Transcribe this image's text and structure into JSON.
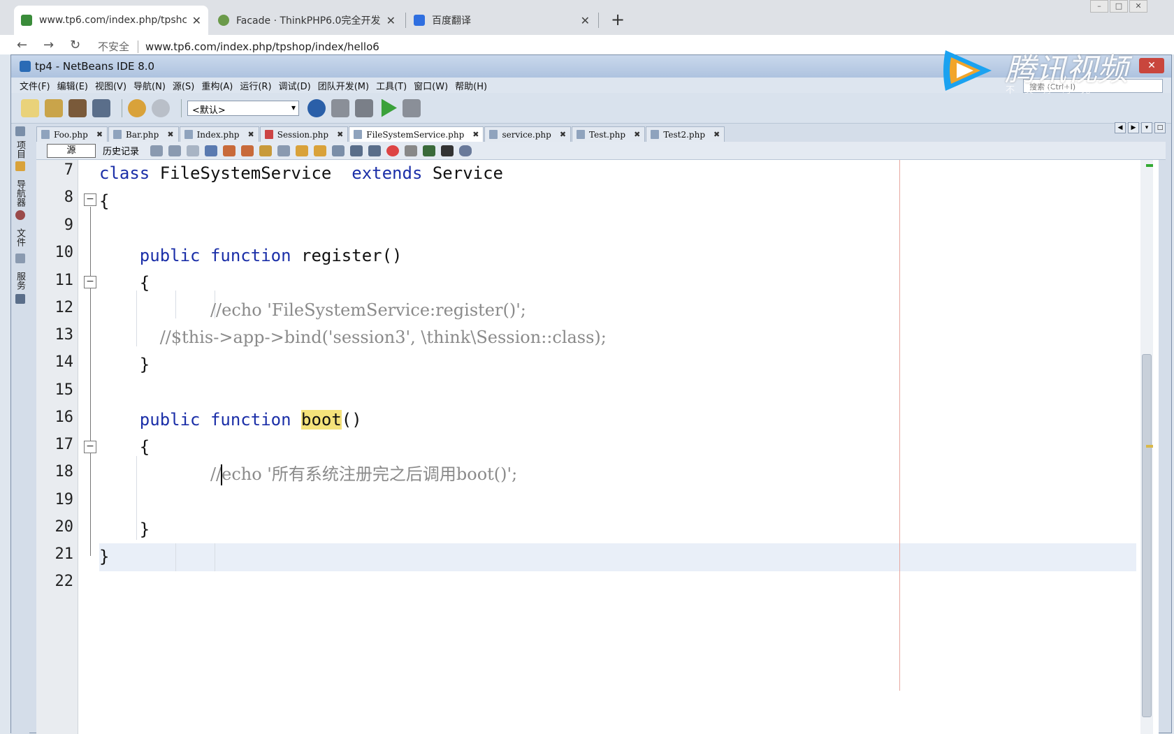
{
  "browser": {
    "tabs": [
      {
        "title": "www.tp6.com/index.php/tpshc",
        "active": true
      },
      {
        "title": "Facade · ThinkPHP6.0完全开发",
        "active": false
      },
      {
        "title": "百度翻译",
        "active": false
      }
    ],
    "url_security": "不安全",
    "url": "www.tp6.com/index.php/tpshop/index/hello6"
  },
  "ide": {
    "title": "tp4 - NetBeans IDE 8.0",
    "menu": [
      "文件(F)",
      "编辑(E)",
      "视图(V)",
      "导航(N)",
      "源(S)",
      "重构(A)",
      "运行(R)",
      "调试(D)",
      "团队开发(M)",
      "工具(T)",
      "窗口(W)",
      "帮助(H)"
    ],
    "search_placeholder": "搜索 (Ctrl+I)",
    "config_select": "<默认>",
    "side_panels": [
      "项目",
      "导航器",
      "文件",
      "服务"
    ],
    "editor_tabs": [
      {
        "label": "Foo.php",
        "active": false
      },
      {
        "label": "Bar.php",
        "active": false
      },
      {
        "label": "Index.php",
        "active": false
      },
      {
        "label": "Session.php",
        "active": false
      },
      {
        "label": "FileSystemService.php",
        "active": true
      },
      {
        "label": "service.php",
        "active": false
      },
      {
        "label": "Test.php",
        "active": false
      },
      {
        "label": "Test2.php",
        "active": false
      }
    ],
    "source_tab": "源",
    "history_tab": "历史记录"
  },
  "code": {
    "line_numbers": [
      "7",
      "8",
      "9",
      "10",
      "11",
      "12",
      "13",
      "14",
      "15",
      "16",
      "17",
      "18",
      "19",
      "20",
      "21",
      "22"
    ],
    "l7": {
      "kw1": "class",
      "name": "FileSystemService",
      "kw2": "extends",
      "parent": "Service"
    },
    "l8": "{",
    "l10": {
      "kw1": "public",
      "kw2": "function",
      "name": "register",
      "rest": "()"
    },
    "l11": "{",
    "l12": "//echo 'FileSystemService:register()';",
    "l13": "//$this->app->bind('session3', \\think\\Session::class);",
    "l14": "}",
    "l16": {
      "kw1": "public",
      "kw2": "function",
      "name": "boot",
      "rest": "()"
    },
    "l17": "{",
    "l18_pre": "//",
    "l18_post": "echo '所有系统注册完之后调用boot()';",
    "l20": "}",
    "l21": "}"
  },
  "watermark": {
    "brand": "腾讯视频",
    "slogan": "不负好时光"
  },
  "colors": {
    "keyword": "#1b2fa8",
    "comment": "#8a8a8a",
    "highlight": "#f4e27a",
    "current_line": "#e9eff8"
  }
}
